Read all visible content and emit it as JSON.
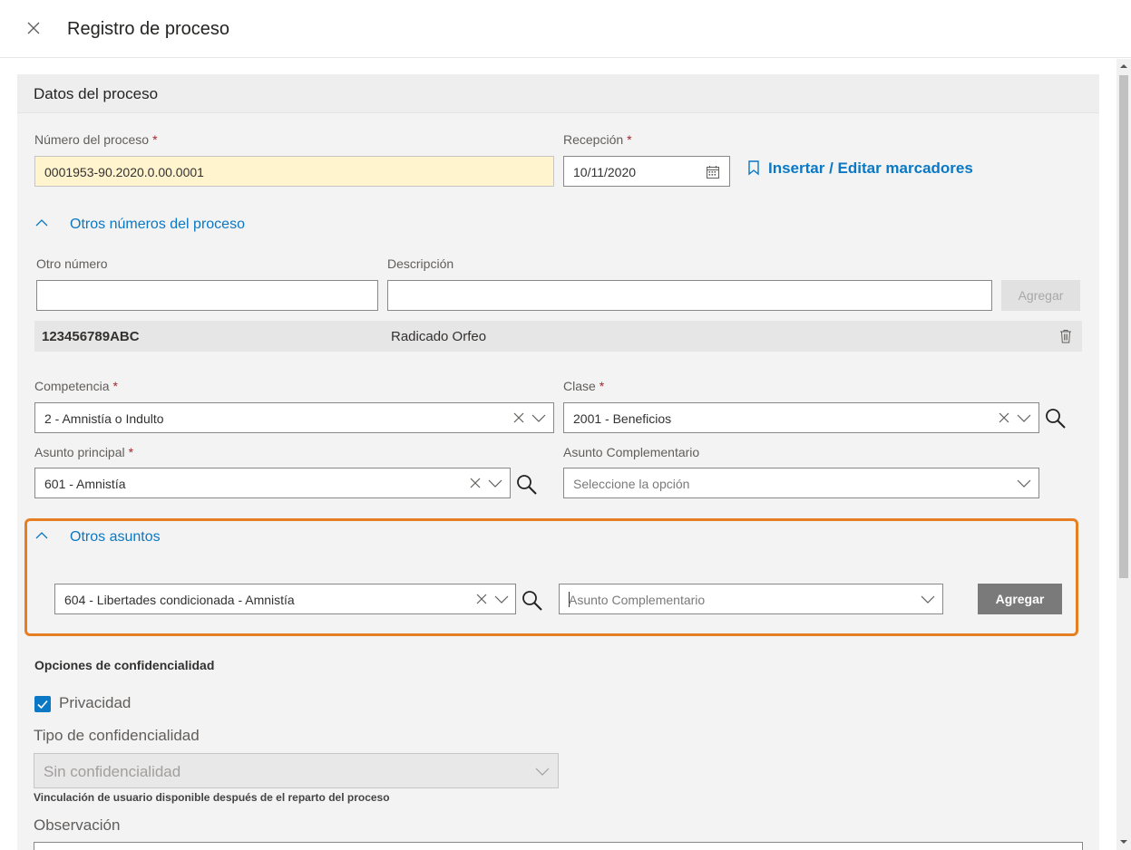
{
  "header": {
    "title": "Registro de proceso"
  },
  "panel": {
    "title": "Datos del proceso"
  },
  "numero": {
    "label": "Número del proceso",
    "required": "*",
    "value": "0001953-90.2020.0.00.0001"
  },
  "recepcion": {
    "label": "Recepción",
    "required": "*",
    "value": "10/11/2020"
  },
  "marcadores": {
    "label": "Insertar / Editar marcadores"
  },
  "otros_numeros": {
    "toggle_label": "Otros números del proceso",
    "col_otro": "Otro número",
    "col_desc": "Descripción",
    "otro_value": "",
    "desc_value": "",
    "add_label": "Agregar",
    "rows": [
      {
        "numero": "123456789ABC",
        "descripcion": "Radicado Orfeo"
      }
    ]
  },
  "competencia": {
    "label": "Competencia",
    "required": "*",
    "value": "2 - Amnistía o Indulto"
  },
  "clase": {
    "label": "Clase",
    "required": "*",
    "value": "2001 - Beneficios"
  },
  "asunto_principal": {
    "label": "Asunto principal",
    "required": "*",
    "value": "601 - Amnistía"
  },
  "asunto_complementario": {
    "label": "Asunto Complementario",
    "placeholder": "Seleccione la opción"
  },
  "otros_asuntos": {
    "toggle_label": "Otros asuntos",
    "asunto_value": "604 - Libertades condicionada - Amnistía",
    "complementario_placeholder": "Asunto Complementario",
    "add_label": "Agregar"
  },
  "confidencialidad": {
    "title": "Opciones de confidencialidad",
    "privacidad_label": "Privacidad",
    "privacidad_checked": true,
    "tipo_label": "Tipo de confidencialidad",
    "tipo_value": "Sin confidencialidad",
    "help": "Vinculación de usuario disponible después de el reparto del proceso",
    "observacion_label": "Observación"
  },
  "colors": {
    "accent": "#0a78c4",
    "highlight": "#e67e22",
    "required": "#a4262c",
    "yellow_field": "#fff4ce"
  }
}
